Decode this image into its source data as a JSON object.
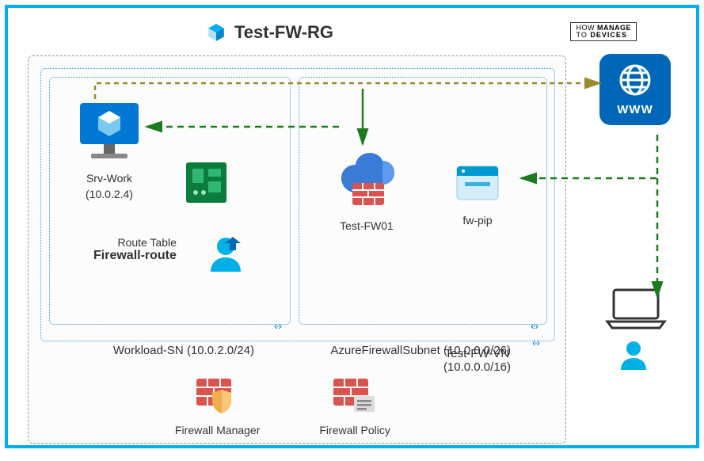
{
  "title": "Test-FW-RG",
  "watermark": {
    "how": "HOW",
    "to": "TO",
    "manage": "MANAGE",
    "devices": "DEVICES"
  },
  "vnet": {
    "name": "Test-FW-VN",
    "cidr": "(10.0.0.0/16)"
  },
  "subnets": {
    "workload": {
      "name": "Workload-SN",
      "cidr": "(10.0.2.0/24)"
    },
    "firewall": {
      "name": "AzureFirewallSubnet",
      "cidr": "(10.0.0.0/26)"
    }
  },
  "vm": {
    "name": "Srv-Work",
    "ip": "(10.0.2.4)"
  },
  "routeTable": {
    "label": "Route Table",
    "name": "Firewall-route"
  },
  "firewall": {
    "name": "Test-FW01"
  },
  "pip": {
    "name": "fw-pip"
  },
  "fwManager": "Firewall Manager",
  "fwPolicy": "Firewall Policy",
  "www": "WWW"
}
